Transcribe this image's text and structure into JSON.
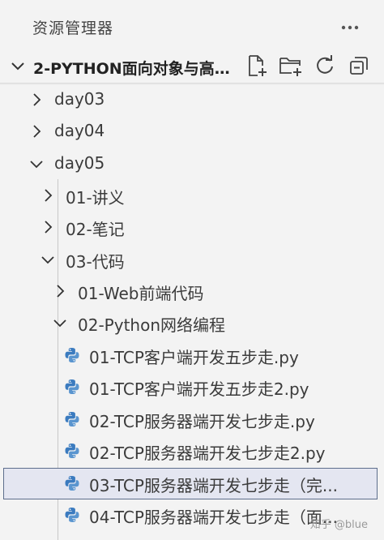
{
  "explorer": {
    "title": "资源管理器",
    "more_icon": "ellipsis-icon"
  },
  "section": {
    "title": "2-PYTHON面向对象与高...",
    "actions": [
      {
        "name": "new-file-button",
        "icon": "new-file-icon"
      },
      {
        "name": "new-folder-button",
        "icon": "new-folder-icon"
      },
      {
        "name": "refresh-button",
        "icon": "refresh-icon"
      },
      {
        "name": "collapse-all-button",
        "icon": "collapse-all-icon"
      }
    ]
  },
  "tree": [
    {
      "label": "day03",
      "type": "folder",
      "expanded": false
    },
    {
      "label": "day04",
      "type": "folder",
      "expanded": false
    },
    {
      "label": "day05",
      "type": "folder",
      "expanded": true
    },
    {
      "label": "01-讲义",
      "type": "folder",
      "expanded": false
    },
    {
      "label": "02-笔记",
      "type": "folder",
      "expanded": false
    },
    {
      "label": "03-代码",
      "type": "folder",
      "expanded": true
    },
    {
      "label": "01-Web前端代码",
      "type": "folder",
      "expanded": false
    },
    {
      "label": "02-Python网络编程",
      "type": "folder",
      "expanded": true
    },
    {
      "label": "01-TCP客户端开发五步走.py",
      "type": "python-file"
    },
    {
      "label": "01-TCP客户端开发五步走2.py",
      "type": "python-file"
    },
    {
      "label": "02-TCP服务器端开发七步走.py",
      "type": "python-file"
    },
    {
      "label": "02-TCP服务器端开发七步走2.py",
      "type": "python-file"
    },
    {
      "label": "03-TCP服务器端开发七步走（完...",
      "type": "python-file",
      "selected": true
    },
    {
      "label": "04-TCP服务器端开发七步走（面...",
      "type": "python-file"
    }
  ],
  "watermark": "知乎 @blue",
  "colors": {
    "background": "#f3f3f3",
    "selected_bg": "#e4e6f1",
    "selected_border": "#5e6e8c",
    "python_blue": "#3b7bbf",
    "python_yellow": "#f5c518"
  }
}
